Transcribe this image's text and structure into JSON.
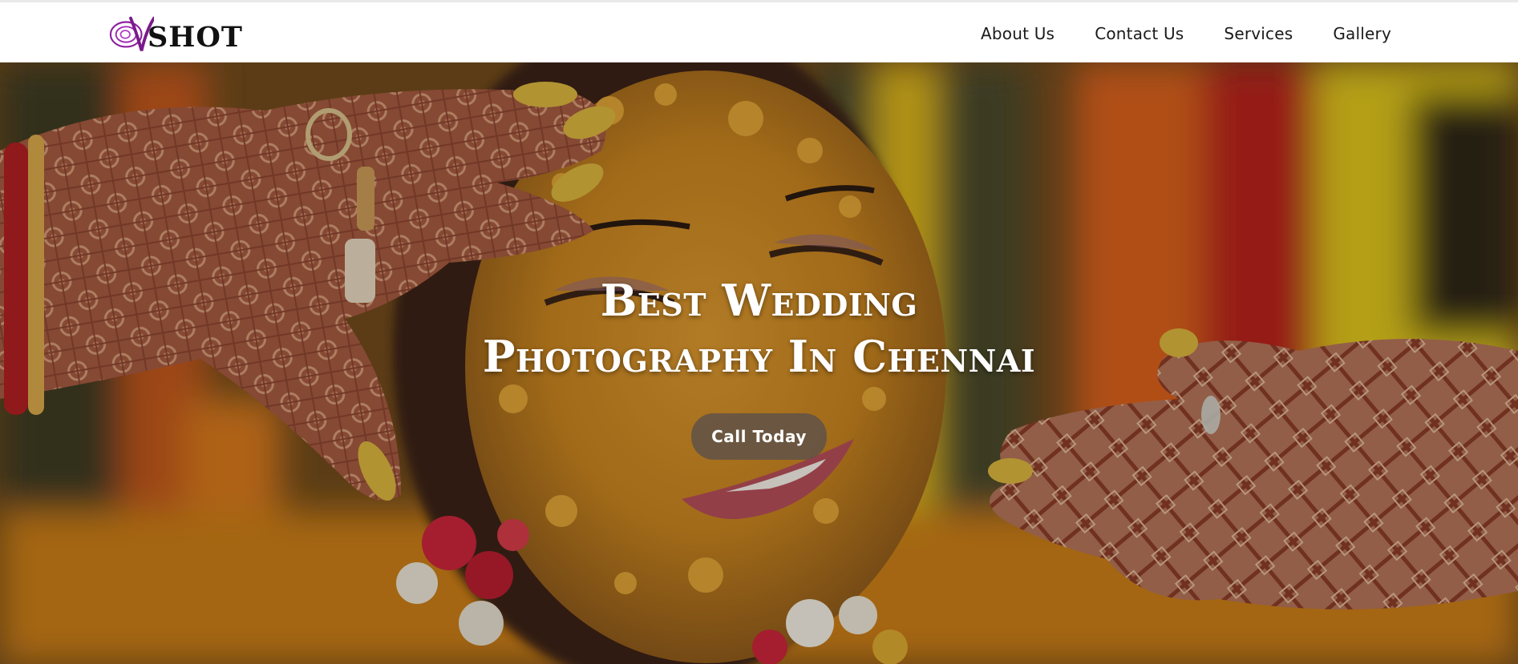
{
  "brand": {
    "logo_text": "SHOT",
    "logo_icon": "swirl-v-logo-icon",
    "logo_color": "#8e1fa0"
  },
  "nav": {
    "items": [
      {
        "label": "About Us"
      },
      {
        "label": "Contact Us"
      },
      {
        "label": "Services"
      },
      {
        "label": "Gallery"
      }
    ]
  },
  "hero": {
    "title_line1": "Best Wedding",
    "title_line2": "Photography In Chennai",
    "cta_label": "Call Today",
    "image_subject": "haldi-ceremony-bride-photo"
  }
}
